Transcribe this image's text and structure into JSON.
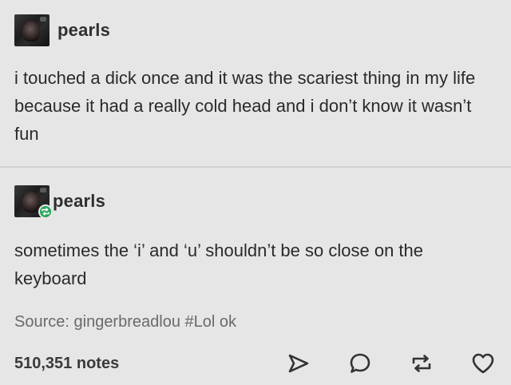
{
  "post": {
    "original": {
      "username": "pearls",
      "text": "i touched a dick once and it was the scariest thing in my life because it had a really cold head and i don’t know it wasn’t fun"
    },
    "reblog": {
      "username": "pearls",
      "text": "sometimes the ‘i’ and ‘u’ shouldn’t be so close on the keyboard"
    },
    "source_label": "Source:",
    "source_name": "gingerbreadlou",
    "tag": "#Lol ok",
    "notes": "510,351 notes"
  },
  "icons": {
    "share": "paper-plane-icon",
    "reply": "speech-bubble-icon",
    "reblog": "reblog-arrows-icon",
    "like": "heart-icon",
    "reblog_badge": "reblog-badge-icon"
  },
  "colors": {
    "background": "#e6e6e6",
    "reblog_badge": "#26a65b",
    "text": "#2a2a2a",
    "muted": "#6a6a6a"
  }
}
